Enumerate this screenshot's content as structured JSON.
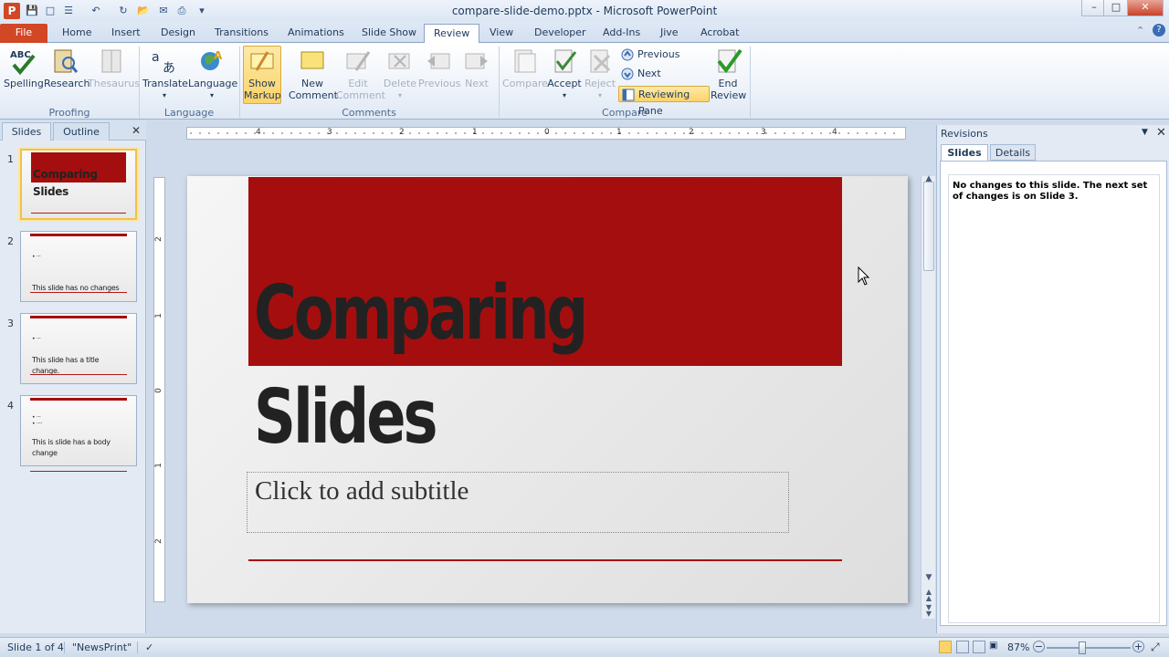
{
  "window": {
    "title": "compare-slide-demo.pptx - Microsoft PowerPoint",
    "app_icon": "P",
    "minimize": "–",
    "maximize": "□",
    "close": "✕"
  },
  "tabs": [
    "File",
    "Home",
    "Insert",
    "Design",
    "Transitions",
    "Animations",
    "Slide Show",
    "Review",
    "View",
    "Developer",
    "Add-Ins",
    "Jive",
    "Acrobat"
  ],
  "active_tab": "Review",
  "ribbon": {
    "proofing": {
      "label": "Proofing",
      "spelling": "Spelling",
      "research": "Research",
      "thesaurus": "Thesaurus"
    },
    "language": {
      "label": "Language",
      "translate": "Translate",
      "language": "Language"
    },
    "comments": {
      "label": "Comments",
      "show_markup_1": "Show",
      "show_markup_2": "Markup",
      "new_comment_1": "New",
      "new_comment_2": "Comment",
      "edit_comment_1": "Edit",
      "edit_comment_2": "Comment",
      "delete": "Delete",
      "previous": "Previous",
      "next": "Next"
    },
    "compare": {
      "label": "Compare",
      "compare": "Compare",
      "accept": "Accept",
      "reject": "Reject",
      "previous": "Previous",
      "next": "Next",
      "reviewing_pane": "Reviewing Pane",
      "end_review_1": "End",
      "end_review_2": "Review"
    }
  },
  "left_pane": {
    "tab_slides": "Slides",
    "tab_outline": "Outline",
    "close": "✕",
    "thumbnails": [
      {
        "num": "1",
        "title": "Comparing",
        "subtitle": "Slides"
      },
      {
        "num": "2",
        "bullet": "• ···",
        "text": "This slide has no changes"
      },
      {
        "num": "3",
        "bullet": "• ···",
        "text1": "This slide has a title",
        "text2": "change."
      },
      {
        "num": "4",
        "bullet1": "• ···",
        "bullet2": "• ····",
        "text1": "This is slide has a body",
        "text2": "change"
      }
    ]
  },
  "hruler_numbers": [
    "4",
    "3",
    "2",
    "1",
    "0",
    "1",
    "2",
    "3",
    "4"
  ],
  "vruler_numbers": [
    "2",
    "1",
    "0",
    "1",
    "2"
  ],
  "slide": {
    "title_line1": "Comparing",
    "title_line2": "Slides",
    "subtitle_placeholder": "Click to add subtitle",
    "accent_color": "#a50e0e"
  },
  "revisions": {
    "title": "Revisions",
    "tab_slides": "Slides",
    "tab_details": "Details",
    "message": "No changes to this slide.  The next set of changes is on Slide 3."
  },
  "status": {
    "slide_of": "Slide 1 of 4",
    "theme": "\"NewsPrint\"",
    "zoom": "87%",
    "zoom_level_percent": 87
  }
}
